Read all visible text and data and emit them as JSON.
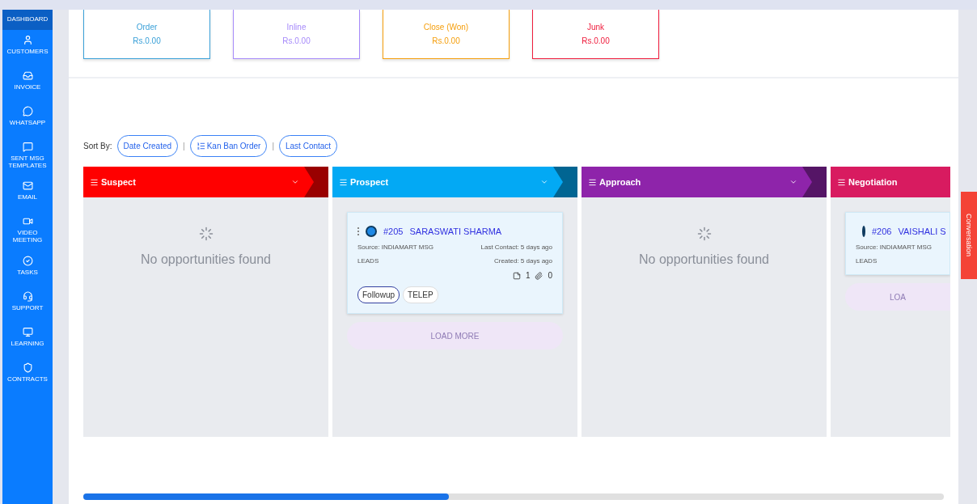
{
  "sidebar": {
    "items": [
      {
        "label": "DASHBOARD",
        "selected": true
      },
      {
        "label": "CUSTOMERS",
        "selected": false
      },
      {
        "label": "INVOICE",
        "selected": false
      },
      {
        "label": "WHATSAPP",
        "selected": false
      },
      {
        "label": "SENT MSG TEMPLATES",
        "selected": false
      },
      {
        "label": "EMAIL",
        "selected": false
      },
      {
        "label": "VIDEO MEETING",
        "selected": false
      },
      {
        "label": "TASKS",
        "selected": false
      },
      {
        "label": "SUPPORT",
        "selected": false
      },
      {
        "label": "LEARNING",
        "selected": false
      },
      {
        "label": "CONTRACTS",
        "selected": false
      }
    ]
  },
  "summary_cards": [
    {
      "title": "Order",
      "amount": "Rs.0.00",
      "color": "#3aa0d8"
    },
    {
      "title": "Inline",
      "amount": "Rs.0.00",
      "color": "#a78bfa"
    },
    {
      "title": "Close (Won)",
      "amount": "Rs.0.00",
      "color": "#f59e0b"
    },
    {
      "title": "Junk",
      "amount": "Rs.0.00",
      "color": "#ef1c3c"
    }
  ],
  "sort_by": {
    "label": "Sort By:",
    "separator": "|",
    "options": [
      "Date Created",
      "Kan Ban Order",
      "Last Contact"
    ]
  },
  "columns": [
    {
      "title": "Suspect",
      "color": "#ff0000",
      "empty_text": "No opportunities found"
    },
    {
      "title": "Prospect",
      "color": "#03a9f4",
      "cards": [
        {
          "id": "#205",
          "name": "SARASWATI SHARMA",
          "source": "Source: INDIAMART MSG",
          "type": "LEADS",
          "last_contact": "Last Contact: 5 days ago",
          "created": "Created: 5 days ago",
          "notes": "1",
          "attachments": "0",
          "tags": [
            "Followup",
            "TELEP"
          ]
        }
      ],
      "load_more": "LOAD MORE"
    },
    {
      "title": "Approach",
      "color": "#8e24aa",
      "empty_text": "No opportunities found"
    },
    {
      "title": "Negotiation",
      "color": "#d81b60",
      "cards": [
        {
          "id": "#206",
          "name": "VAISHALI S",
          "source": "Source: INDIAMART MSG",
          "type": "LEADS"
        }
      ],
      "load_more": "LOA"
    }
  ],
  "conversation_tab": "Conversation"
}
